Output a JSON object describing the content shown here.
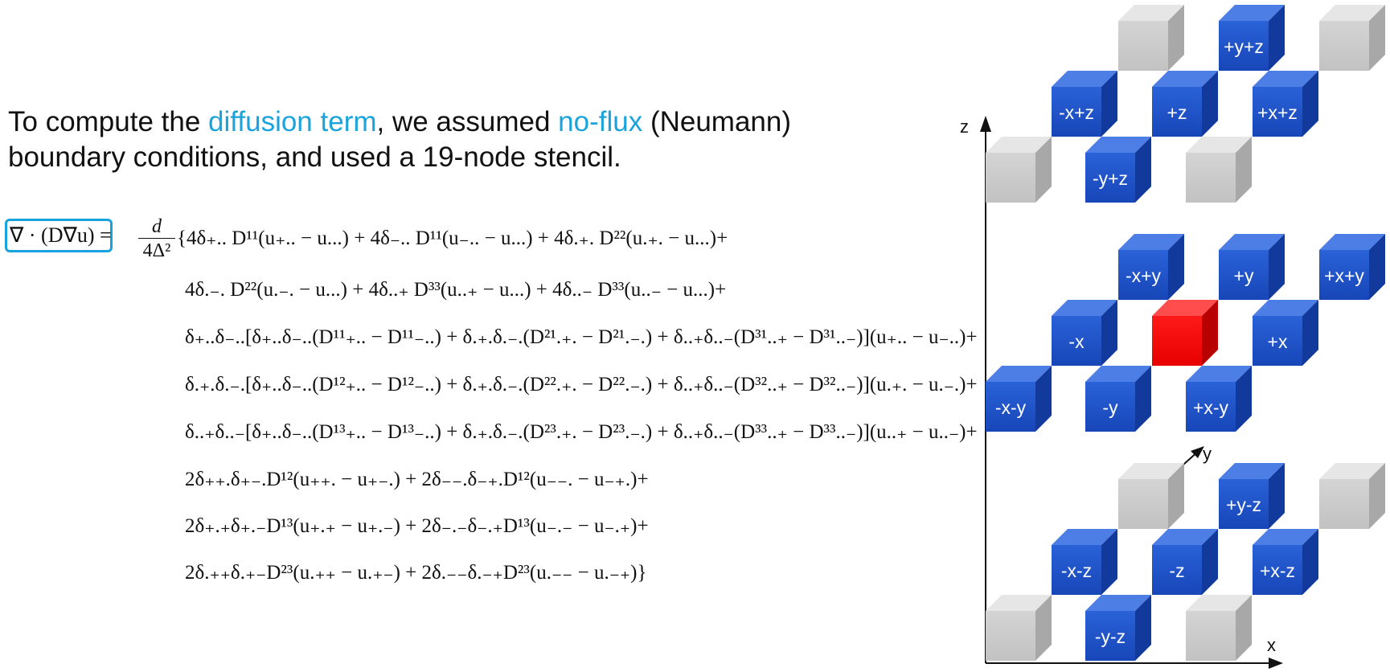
{
  "intro": {
    "t1": "To compute the ",
    "h1": "diffusion term",
    "t2": ", we assumed ",
    "h2": "no-flux",
    "t3": " (Neumann)",
    "t4": "boundary conditions, and used a 19-node stencil."
  },
  "equation": {
    "lhs": "∇ · (D∇u)",
    "equals": "=",
    "frac_num": "d",
    "frac_den": "4Δ²",
    "lines": [
      "{4δ₊.. D¹¹(u₊.. − u...) + 4δ₋.. D¹¹(u₋.. − u...) + 4δ.₊. D²²(u.₊. − u...)+",
      "4δ.₋. D²²(u.₋. − u...) + 4δ..₊ D³³(u..₊ − u...) + 4δ..₋ D³³(u..₋ − u...)+",
      "δ₊..δ₋..[δ₊..δ₋..(D¹¹₊.. − D¹¹₋..) + δ.₊.δ.₋.(D²¹.₊. − D²¹.₋.) + δ..₊δ..₋(D³¹..₊ − D³¹..₋)](u₊.. − u₋..)+",
      "δ.₊.δ.₋.[δ₊..δ₋..(D¹²₊.. − D¹²₋..) + δ.₊.δ.₋.(D²².₊. − D²².₋.) + δ..₊δ..₋(D³²..₊ − D³²..₋)](u.₊. − u.₋.)+",
      "δ..₊δ..₋[δ₊..δ₋..(D¹³₊.. − D¹³₋..) + δ.₊.δ.₋.(D²³.₊. − D²³.₋.) + δ..₊δ..₋(D³³..₊ − D³³..₋)](u..₊ − u..₋)+",
      "2δ₊₊.δ₊₋.D¹²(u₊₊. − u₊₋.) + 2δ₋₋.δ₋₊.D¹²(u₋₋. − u₋₊.)+",
      "2δ₊.₊δ₊.₋D¹³(u₊.₊ − u₊.₋) + 2δ₋.₋δ₋.₊D¹³(u₋.₋ − u₋.₊)+",
      "2δ.₊₊δ.₊₋D²³(u.₊₊ − u.₊₋) + 2δ.₋₋δ.₋₊D²³(u.₋₋ − u.₋₊)}"
    ]
  },
  "axes": {
    "z": "z",
    "y": "y",
    "x": "x"
  },
  "colors": {
    "accent_text": "#1ba3dc",
    "box_border": "#16a2dc",
    "cube_blue": "#1c52cc",
    "cube_center": "#ee0000",
    "cube_gray": "#cccccc"
  },
  "stencil": {
    "top_layer": [
      "+y+z",
      "-x+z",
      "+z",
      "+x+z",
      "-y+z"
    ],
    "middle_layer": [
      "-x+y",
      "+y",
      "+x+y",
      "-x",
      "+x",
      "-x-y",
      "-y",
      "+x-y"
    ],
    "bottom_layer": [
      "+y-z",
      "-x-z",
      "-z",
      "+x-z",
      "-y-z"
    ]
  }
}
